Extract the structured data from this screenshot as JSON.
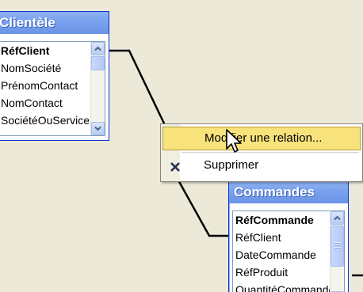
{
  "tables": {
    "clientele": {
      "title": "Clientèle",
      "fields": [
        {
          "name": "RéfClient",
          "primary_key": true
        },
        {
          "name": "NomSociété",
          "primary_key": false
        },
        {
          "name": "PrénomContact",
          "primary_key": false
        },
        {
          "name": "NomContact",
          "primary_key": false
        },
        {
          "name": "SociétéOuService",
          "primary_key": false
        }
      ]
    },
    "commandes": {
      "title": "Commandes",
      "fields": [
        {
          "name": "RéfCommande",
          "primary_key": true
        },
        {
          "name": "RéfClient",
          "primary_key": false
        },
        {
          "name": "DateCommande",
          "primary_key": false
        },
        {
          "name": "RéfProduit",
          "primary_key": false
        },
        {
          "name": "QuantitéCommandée",
          "primary_key": false
        }
      ]
    }
  },
  "context_menu": {
    "items": [
      {
        "label": "Modifier une relation...",
        "icon": "none",
        "highlighted": true
      },
      {
        "label": "Supprimer",
        "icon": "delete-x-icon",
        "highlighted": false
      }
    ]
  },
  "colors": {
    "titlebar": "#7aa2ee",
    "menu_highlight": "#f7e27c",
    "background": "#ece9d8"
  }
}
